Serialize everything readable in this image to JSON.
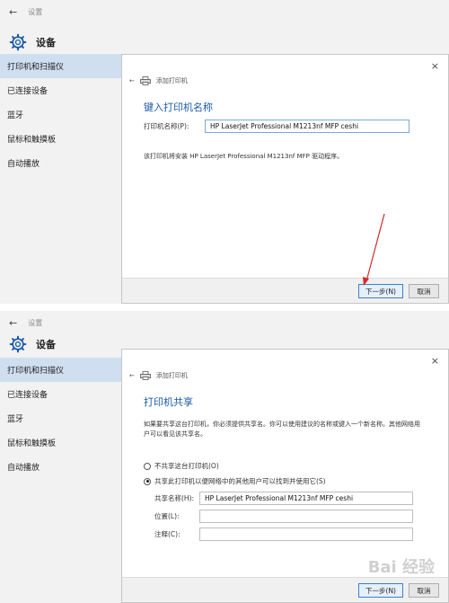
{
  "app": {
    "back_glyph": "←",
    "window_title": "设置",
    "header_title": "设备"
  },
  "sidebar": {
    "items": [
      {
        "label": "打印机和扫描仪"
      },
      {
        "label": "已连接设备"
      },
      {
        "label": "蓝牙"
      },
      {
        "label": "鼠标和触摸板"
      },
      {
        "label": "自动播放"
      }
    ]
  },
  "dialog1": {
    "close_glyph": "×",
    "nav_back_glyph": "←",
    "nav_title": "添加打印机",
    "heading": "键入打印机名称",
    "name_label": "打印机名称(P):",
    "name_value": "HP LaserJet Professional M1213nf MFP ceshi",
    "driver_note": "该打印机将安装 HP LaserJet Professional M1213nf MFP 驱动程序。",
    "next_label": "下一步(N)",
    "cancel_label": "取消"
  },
  "dialog2": {
    "close_glyph": "×",
    "nav_back_glyph": "←",
    "nav_title": "添加打印机",
    "heading": "打印机共享",
    "description": "如果要共享这台打印机，你必须提供共享名。你可以使用建议的名称或键入一个新名称。其他网络用户可以看见该共享名。",
    "option_no_share": "不共享这台打印机(O)",
    "option_share": "共享此打印机以便网络中的其他用户可以找到并使用它(S)",
    "share_name_label": "共享名称(H):",
    "share_name_value": "HP LaserJet Professional M1213nf MFP ceshi",
    "location_label": "位置(L):",
    "location_value": "",
    "comment_label": "注释(C):",
    "comment_value": "",
    "next_label": "下一步(N)",
    "cancel_label": "取消"
  },
  "watermark": "Bai 经验",
  "colors": {
    "accent": "#1a5aa6",
    "sidebar_active": "#cfdff0",
    "arrow": "#d22a2a"
  }
}
